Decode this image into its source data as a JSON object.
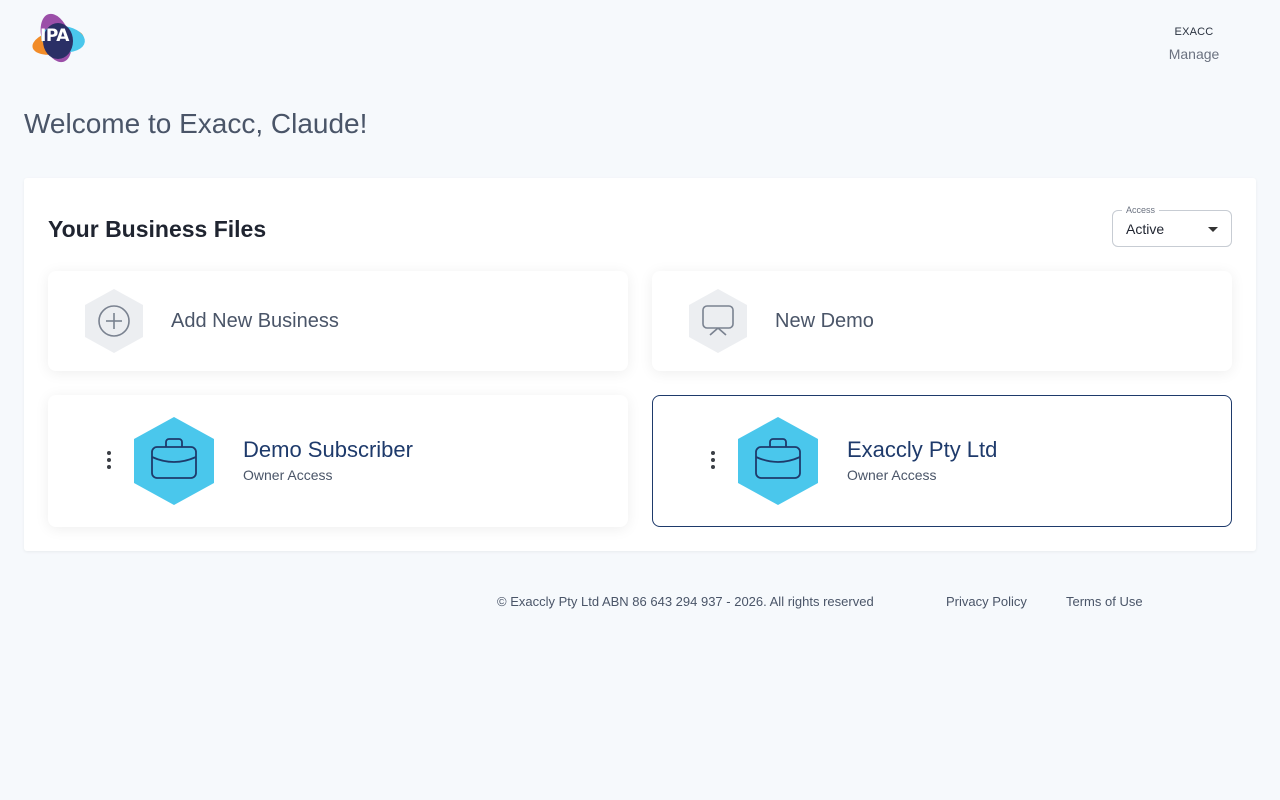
{
  "header": {
    "logo_icon": "ipa-logo-icon",
    "logo_text": "IPA",
    "org_name": "EXACC",
    "manage_label": "Manage"
  },
  "welcome": "Welcome to Exacc, Claude!",
  "panel": {
    "title": "Your Business Files",
    "access": {
      "legend": "Access",
      "value": "Active"
    },
    "actions": [
      {
        "label": "Add New Business",
        "icon": "plus-circle-icon"
      },
      {
        "label": "New Demo",
        "icon": "presentation-screen-icon"
      }
    ],
    "businesses": [
      {
        "name": "Demo Subscriber",
        "access": "Owner Access",
        "icon": "briefcase-icon",
        "selected": false
      },
      {
        "name": "Exaccly Pty Ltd",
        "access": "Owner Access",
        "icon": "briefcase-icon",
        "selected": true
      }
    ]
  },
  "footer": {
    "copyright": "© Exaccly Pty Ltd ABN 86 643 294 937 - 2026. All rights reserved",
    "privacy": "Privacy Policy",
    "terms": "Terms of Use"
  },
  "colors": {
    "accent": "#4ac7ec",
    "navy": "#1e3a6b",
    "background": "#f6f9fc"
  }
}
